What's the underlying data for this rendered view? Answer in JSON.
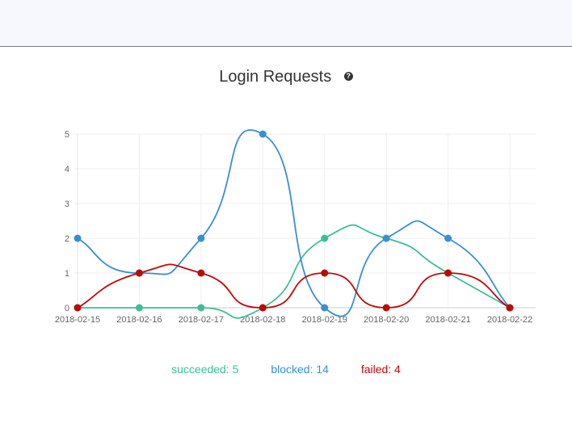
{
  "chart_data": {
    "type": "line",
    "title": "Login Requests",
    "categories": [
      "2018-02-15",
      "2018-02-16",
      "2018-02-17",
      "2018-02-18",
      "2018-02-19",
      "2018-02-20",
      "2018-02-21",
      "2018-02-22"
    ],
    "ylim": [
      0,
      5
    ],
    "yticks": [
      0,
      1,
      2,
      3,
      4,
      5
    ],
    "grid": true,
    "legend_position": "bottom",
    "series": [
      {
        "name": "succeeded",
        "color": "#3dbd98",
        "values": [
          0,
          0,
          0,
          0,
          2,
          2,
          1,
          0
        ]
      },
      {
        "name": "blocked",
        "color": "#3a8fd0",
        "values": [
          2,
          1,
          2,
          5,
          0,
          2,
          2,
          0
        ]
      },
      {
        "name": "failed",
        "color": "#bb0a0a",
        "values": [
          0,
          1,
          1,
          0,
          1,
          0,
          1,
          0
        ]
      }
    ]
  },
  "legend": {
    "succeeded": "succeeded: 5",
    "blocked": "blocked: 14",
    "failed": "failed: 4"
  },
  "icons": {
    "help": "question-circle-icon"
  }
}
